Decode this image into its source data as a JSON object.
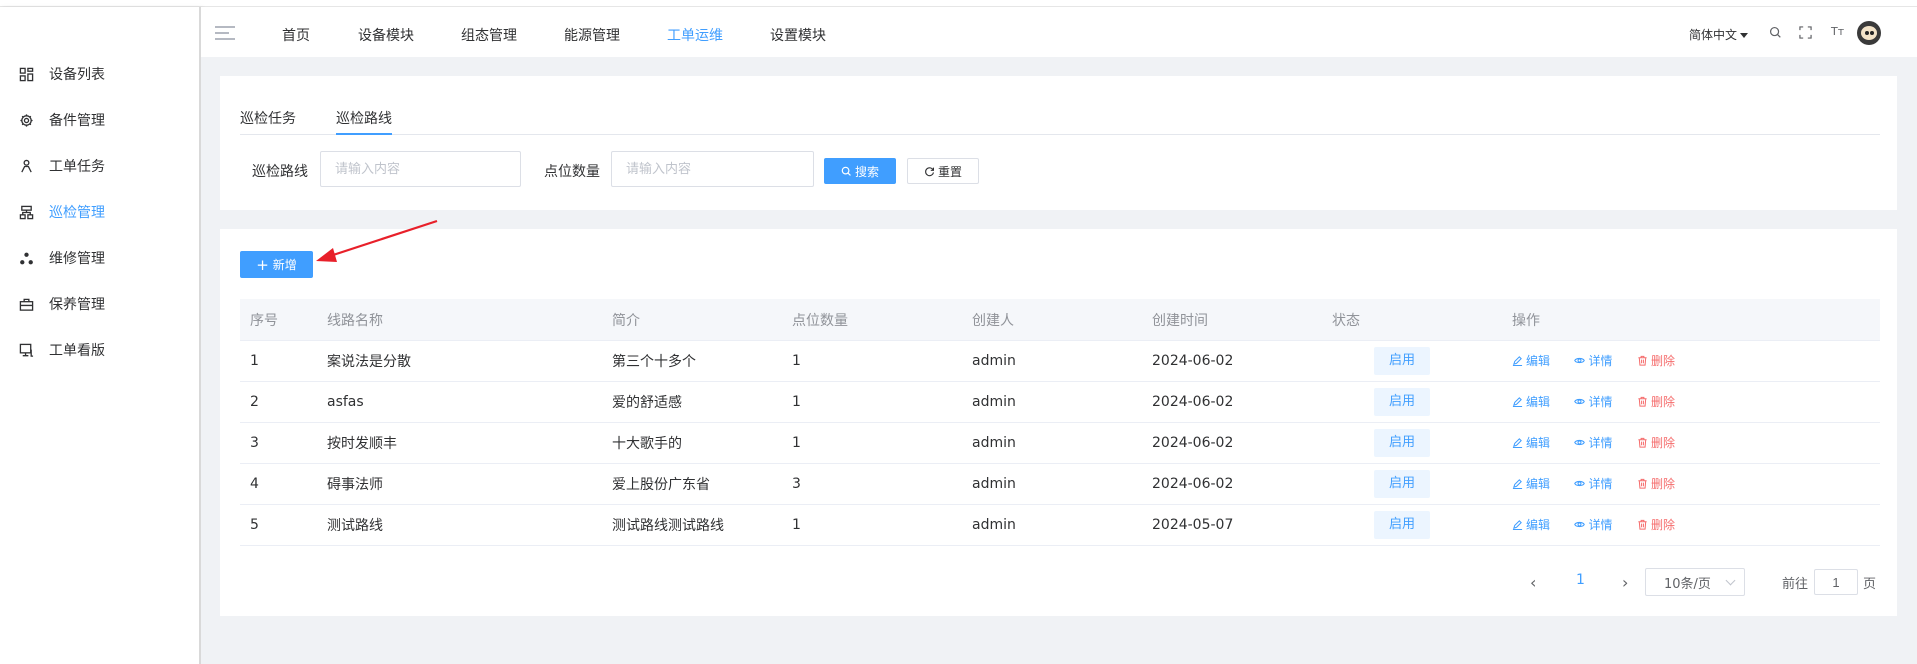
{
  "sidebar": {
    "items": [
      {
        "label": "设备列表",
        "icon": "grid-icon"
      },
      {
        "label": "备件管理",
        "icon": "gear-icon"
      },
      {
        "label": "工单任务",
        "icon": "person-icon"
      },
      {
        "label": "巡检管理",
        "icon": "hierarchy-icon",
        "active": true
      },
      {
        "label": "维修管理",
        "icon": "nodes-icon"
      },
      {
        "label": "保养管理",
        "icon": "toolbox-icon"
      },
      {
        "label": "工单看版",
        "icon": "monitor-icon"
      }
    ]
  },
  "topnav": {
    "items": [
      "首页",
      "设备模块",
      "组态管理",
      "能源管理",
      "工单运维",
      "设置模块"
    ],
    "active_index": 4,
    "language": "简体中文",
    "font_size_label": "Tт"
  },
  "tabs": [
    "巡检任务",
    "巡检路线"
  ],
  "active_tab": 1,
  "search": {
    "route_label": "巡检路线",
    "route_placeholder": "请输入内容",
    "points_label": "点位数量",
    "points_placeholder": "请输入内容",
    "search_button": "搜索",
    "reset_button": "重置"
  },
  "add_button": "新增",
  "table": {
    "columns": [
      "序号",
      "线路名称",
      "简介",
      "点位数量",
      "创建人",
      "创建时间",
      "状态",
      "操作"
    ],
    "rows": [
      {
        "no": "1",
        "name": "案说法是分散",
        "intro": "第三个十多个",
        "points": "1",
        "creator": "admin",
        "created": "2024-06-02",
        "status": "启用"
      },
      {
        "no": "2",
        "name": "asfas",
        "intro": "爱的舒适感",
        "points": "1",
        "creator": "admin",
        "created": "2024-06-02",
        "status": "启用"
      },
      {
        "no": "3",
        "name": "按时发顺丰",
        "intro": "十大歌手的",
        "points": "1",
        "creator": "admin",
        "created": "2024-06-02",
        "status": "启用"
      },
      {
        "no": "4",
        "name": "碍事法师",
        "intro": "爱上股份广东省",
        "points": "3",
        "creator": "admin",
        "created": "2024-06-02",
        "status": "启用"
      },
      {
        "no": "5",
        "name": "测试路线",
        "intro": "测试路线测试路线",
        "points": "1",
        "creator": "admin",
        "created": "2024-05-07",
        "status": "启用"
      }
    ],
    "actions": {
      "edit": "编辑",
      "detail": "详情",
      "delete": "删除"
    }
  },
  "pagination": {
    "current_page": "1",
    "page_size": "10条/页",
    "goto_label": "前往",
    "goto_value": "1",
    "page_suffix": "页"
  },
  "colors": {
    "accent": "#409eff",
    "danger": "#f56c6c",
    "annotation_arrow": "#e8202a"
  }
}
